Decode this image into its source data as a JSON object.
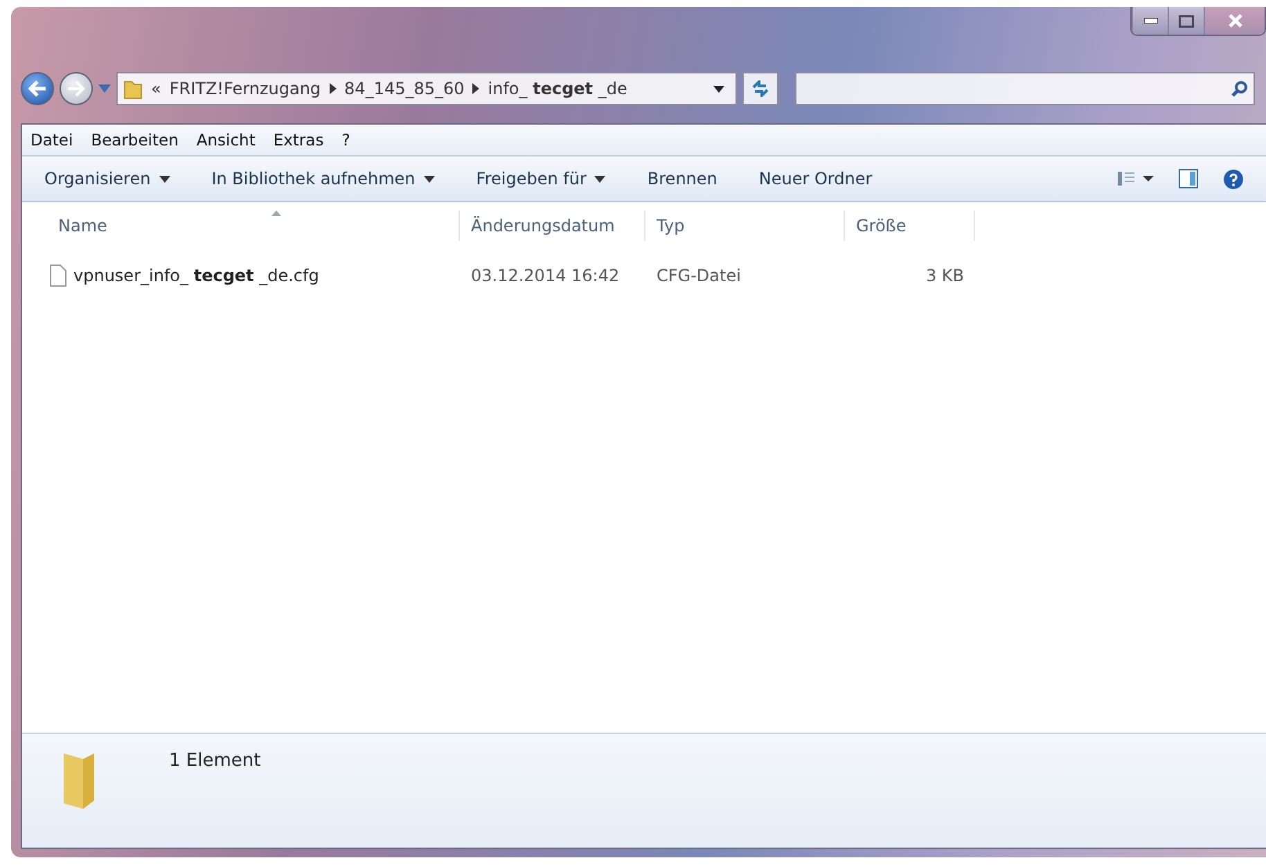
{
  "address_bar": {
    "overflow": "«",
    "segments": [
      "FRITZ!Fernzugang",
      "84_145_85_60",
      "info_ **tecget** _de"
    ]
  },
  "menu": [
    "Datei",
    "Bearbeiten",
    "Ansicht",
    "Extras",
    "?"
  ],
  "toolbar": [
    {
      "label": "Organisieren",
      "dropdown": true
    },
    {
      "label": "In Bibliothek aufnehmen",
      "dropdown": true
    },
    {
      "label": "Freigeben für",
      "dropdown": true
    },
    {
      "label": "Brennen",
      "dropdown": false
    },
    {
      "label": "Neuer Ordner",
      "dropdown": false
    }
  ],
  "columns": [
    "Name",
    "Änderungsdatum",
    "Typ",
    "Größe"
  ],
  "rows": [
    {
      "name": "vpnuser_info_ **tecget** _de.cfg",
      "date": "03.12.2014 16:42",
      "type": "CFG-Datei",
      "size": "3 KB"
    }
  ],
  "status_bar": {
    "count": "1 Element"
  }
}
